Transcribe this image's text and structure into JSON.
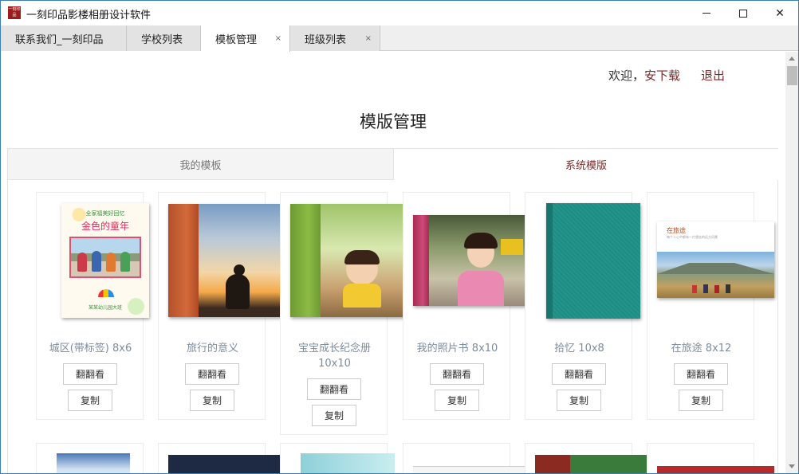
{
  "app": {
    "title": "一刻印品影楼相册设计软件",
    "logo_text": "一刻印品"
  },
  "window_controls": {
    "minimize": "minimize-icon",
    "maximize": "maximize-icon",
    "close": "close-icon",
    "close_glyph": "✕"
  },
  "tabs": [
    {
      "label": "联系我们_一刻印品",
      "closable": false,
      "active": false
    },
    {
      "label": "学校列表",
      "closable": false,
      "active": false
    },
    {
      "label": "模板管理",
      "closable": true,
      "active": true
    },
    {
      "label": "班级列表",
      "closable": true,
      "active": false
    }
  ],
  "tab_close_glyph": "×",
  "header": {
    "welcome": "欢迎，",
    "username": "安下载",
    "logout": "退出"
  },
  "page_title": "模版管理",
  "panel_tabs": {
    "mine": "我的模板",
    "system": "系统模版",
    "active": "system"
  },
  "templates": [
    {
      "name": "城区(带标签) 8x6",
      "cover": "school-album-cover"
    },
    {
      "name": "旅行的意义",
      "cover": "sunset-silhouette-cover"
    },
    {
      "name": "宝宝成长纪念册 10x10",
      "cover": "baby-growth-cover"
    },
    {
      "name": "我的照片书 8x10",
      "cover": "girl-portrait-cover"
    },
    {
      "name": "拾忆 10x8",
      "cover": "teal-linen-cover"
    },
    {
      "name": "在旅途 8x12",
      "cover": "mountain-landscape-cover"
    }
  ],
  "buttons": {
    "flip": "翻翻看",
    "copy": "复制"
  },
  "cover_texts": {
    "school_title": "金色的童年",
    "school_top": "全家福美好回忆",
    "school_bottom": "某某幼儿园大班",
    "travel_title": "在旅途",
    "travel_sub": "每个人心中都有一片想去的远方风景"
  },
  "colors": {
    "accent": "#7a2a2a",
    "window_border": "#3c7fb1",
    "card_name": "#7d8b9d"
  }
}
